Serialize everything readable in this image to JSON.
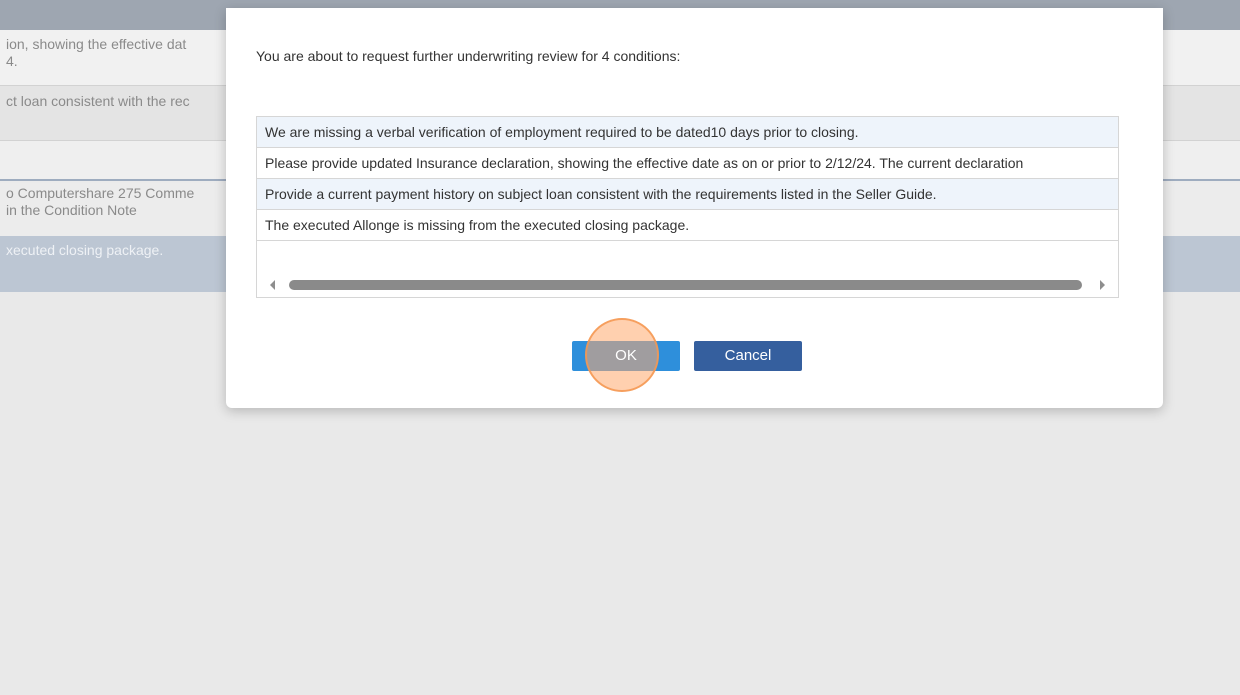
{
  "background": {
    "rows": [
      {
        "line1": "ion, showing the effective dat",
        "line2": "4."
      },
      {
        "line1": "ct loan consistent with the rec",
        "line2": ""
      },
      {
        "line1": "",
        "line2": ""
      },
      {
        "line1": "o Computershare 275 Comme",
        "line2": "in the Condition Note"
      },
      {
        "line1": "xecuted closing package.",
        "line2": ""
      }
    ]
  },
  "dialog": {
    "message": "You are about to request further underwriting review for 4 conditions:",
    "conditions": [
      "We are missing a verbal verification of employment required to be dated10 days prior to closing.",
      "Please provide updated Insurance declaration, showing the effective date as on or prior to 2/12/24. The current declaration",
      "Provide a current payment history on subject loan consistent with the requirements listed in the Seller Guide.",
      "The executed Allonge is missing from the executed closing package."
    ],
    "ok_label": "OK",
    "cancel_label": "Cancel"
  },
  "colors": {
    "ok_button": "#2e8fdb",
    "cancel_button": "#355f9e",
    "click_indicator": "#f5a06a"
  }
}
